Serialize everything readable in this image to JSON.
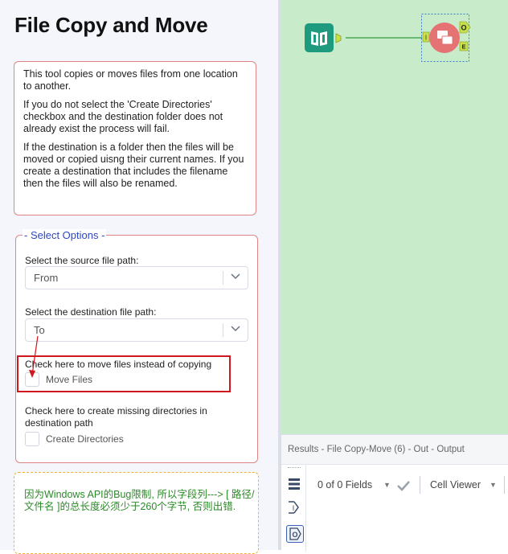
{
  "config": {
    "title": "File Copy and Move",
    "description": [
      "This tool copies or moves files from one location to another.",
      "If you do not select the 'Create Directories' checkbox and the destination folder does not already exist the process will fail.",
      "If the destination is a folder then the files will be moved or copied uisng their current names. If you create a destination that includes the filename then the files will also be renamed."
    ],
    "options": {
      "legend": "- Select Options -",
      "source_label": "Select the source file path:",
      "source_value": "From",
      "dest_label": "Select the destination file path:",
      "dest_value": "To",
      "move_label": "Check here to move files instead of copying",
      "move_checkbox_label": "Move Files",
      "move_checked": false,
      "create_label": "Check here to create missing directories in destination path",
      "create_checkbox_label": "Create Directories",
      "create_checked": false
    },
    "note": "因为Windows API的Bug限制, 所以字段列---> [ 路径/文件名 ]的总长度必须少于260个字节, 否则出错."
  },
  "canvas": {
    "input_tool": "book-input-icon",
    "macro_tool": "file-copy-move-macro-icon",
    "anchors": {
      "input": "I",
      "output": "O",
      "error": "E"
    }
  },
  "results": {
    "title": "Results - File Copy-Move (6) - Out - Output",
    "fields_text": "0 of 0 Fields",
    "cell_viewer": "Cell Viewer"
  },
  "colors": {
    "canvas_bg": "#c8ebca",
    "panel_border": "#e08585",
    "legend_text": "#2e47c6",
    "highlight": "#d0171d",
    "note_border": "#f2b233",
    "note_text": "#2b8a28",
    "input_tool": "#1e9a7f",
    "macro_tool": "#e57373",
    "anchor": "#c6e04a"
  }
}
